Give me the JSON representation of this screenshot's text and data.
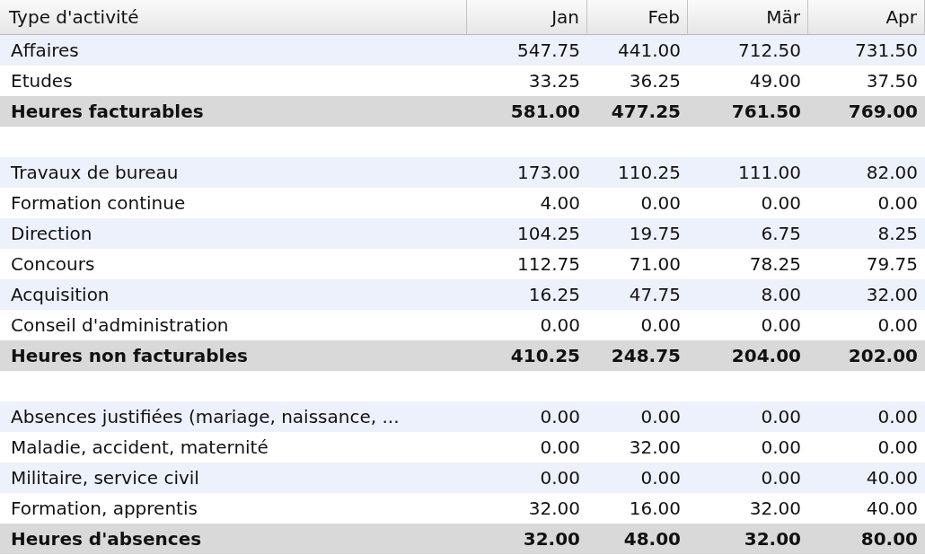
{
  "table": {
    "columns": [
      "Type d'activité",
      "Jan",
      "Feb",
      "Mär",
      "Apr"
    ],
    "groups": [
      {
        "rows": [
          {
            "label": "Affaires",
            "values": [
              "547.75",
              "441.00",
              "712.50",
              "731.50"
            ]
          },
          {
            "label": "Etudes",
            "values": [
              "33.25",
              "36.25",
              "49.00",
              "37.50"
            ]
          }
        ],
        "total": {
          "label": "Heures facturables",
          "values": [
            "581.00",
            "477.25",
            "761.50",
            "769.00"
          ]
        }
      },
      {
        "rows": [
          {
            "label": "Travaux de bureau",
            "values": [
              "173.00",
              "110.25",
              "111.00",
              "82.00"
            ]
          },
          {
            "label": "Formation continue",
            "values": [
              "4.00",
              "0.00",
              "0.00",
              "0.00"
            ]
          },
          {
            "label": "Direction",
            "values": [
              "104.25",
              "19.75",
              "6.75",
              "8.25"
            ]
          },
          {
            "label": "Concours",
            "values": [
              "112.75",
              "71.00",
              "78.25",
              "79.75"
            ]
          },
          {
            "label": "Acquisition",
            "values": [
              "16.25",
              "47.75",
              "8.00",
              "32.00"
            ]
          },
          {
            "label": "Conseil d'administration",
            "values": [
              "0.00",
              "0.00",
              "0.00",
              "0.00"
            ]
          }
        ],
        "total": {
          "label": "Heures non facturables",
          "values": [
            "410.25",
            "248.75",
            "204.00",
            "202.00"
          ]
        }
      },
      {
        "rows": [
          {
            "label": "Absences justifiées (mariage, naissance, ...",
            "values": [
              "0.00",
              "0.00",
              "0.00",
              "0.00"
            ]
          },
          {
            "label": "Maladie, accident, maternité",
            "values": [
              "0.00",
              "32.00",
              "0.00",
              "0.00"
            ]
          },
          {
            "label": "Militaire, service civil",
            "values": [
              "0.00",
              "0.00",
              "0.00",
              "40.00"
            ]
          },
          {
            "label": "Formation, apprentis",
            "values": [
              "32.00",
              "16.00",
              "32.00",
              "40.00"
            ]
          }
        ],
        "total": {
          "label": "Heures d'absences",
          "values": [
            "32.00",
            "48.00",
            "32.00",
            "80.00"
          ]
        }
      }
    ]
  }
}
